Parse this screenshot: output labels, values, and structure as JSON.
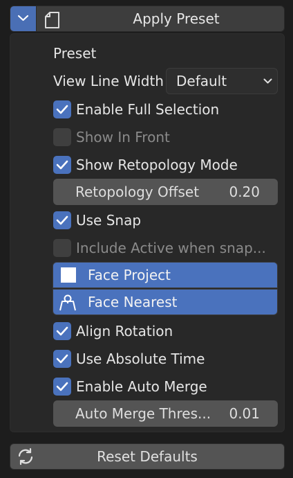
{
  "header": {
    "title": "Apply Preset",
    "collapse_icon": "chevron-down-icon",
    "doc_icon": "document-icon"
  },
  "panel": {
    "preset_label": "Preset",
    "view_line_width": {
      "label": "View Line Width",
      "value": "Default"
    },
    "options": [
      {
        "label": "Enable Full Selection",
        "checked": true,
        "enabled": true
      },
      {
        "label": "Show In Front",
        "checked": false,
        "enabled": false
      },
      {
        "label": "Show Retopology Mode",
        "checked": true,
        "enabled": true
      }
    ],
    "retopology_offset": {
      "label": "Retopology Offset",
      "value": "0.20"
    },
    "use_snap": {
      "label": "Use Snap",
      "checked": true
    },
    "include_active": {
      "label": "Include Active when snap...",
      "checked": false,
      "enabled": false
    },
    "snap_modes": [
      {
        "label": "Face Project",
        "icon": "face-project-icon",
        "selected": true
      },
      {
        "label": "Face Nearest",
        "icon": "face-nearest-icon",
        "selected": true
      }
    ],
    "options2": [
      {
        "label": "Align Rotation",
        "checked": true
      },
      {
        "label": "Use Absolute Time",
        "checked": true
      },
      {
        "label": "Enable Auto Merge",
        "checked": true
      }
    ],
    "auto_merge": {
      "label": "Auto Merge Thres...",
      "value": "0.01"
    }
  },
  "footer": {
    "reset_label": "Reset Defaults",
    "reset_icon": "refresh-icon"
  },
  "colors": {
    "accent": "#4a72bd",
    "panel_bg": "#282828",
    "field_bg": "#545454"
  }
}
